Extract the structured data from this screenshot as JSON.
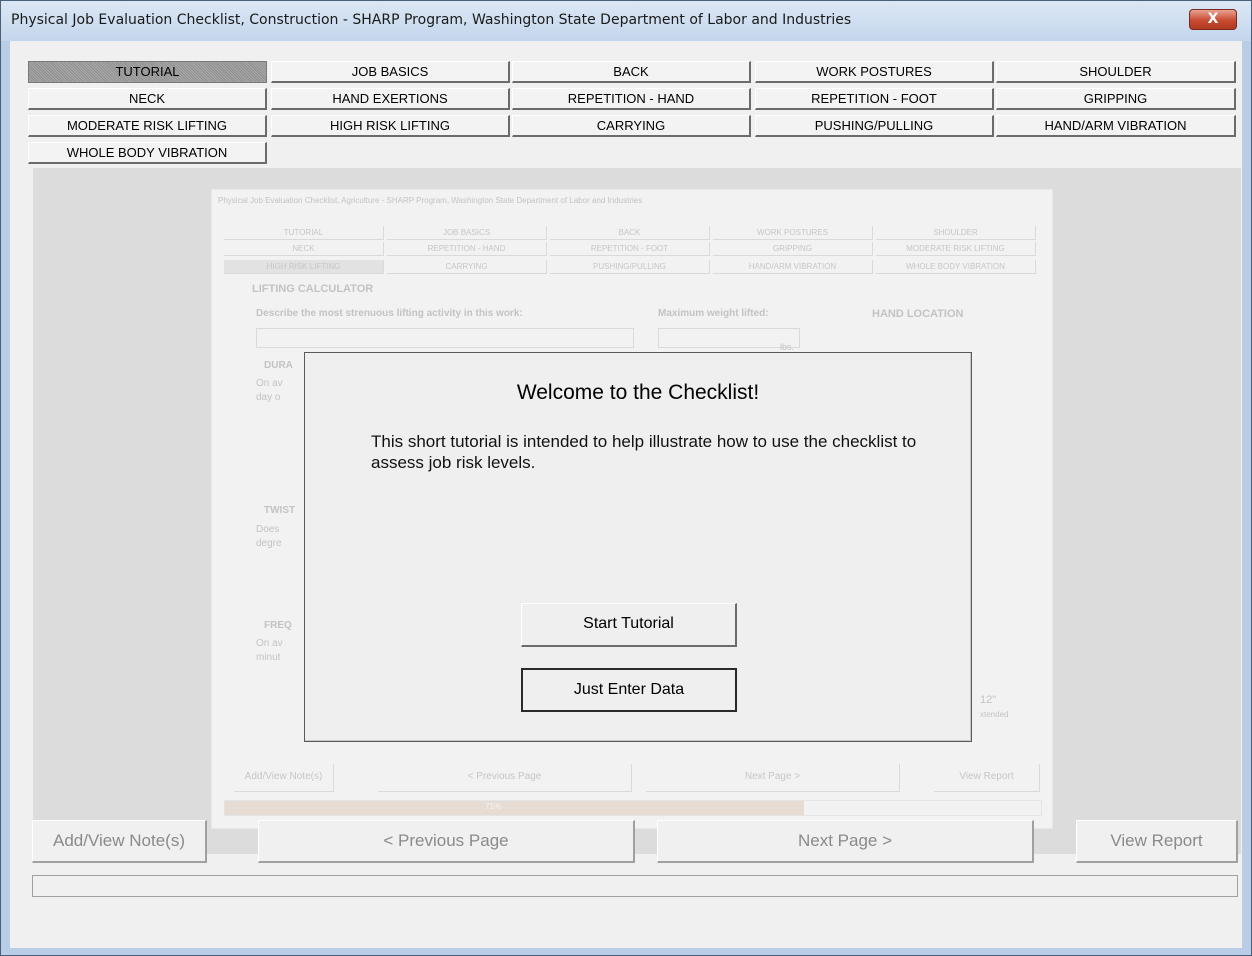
{
  "window": {
    "title": "Physical Job Evaluation Checklist, Construction - SHARP Program, Washington State Department of Labor and Industries",
    "close_glyph": "X"
  },
  "tabs": [
    "TUTORIAL",
    "JOB BASICS",
    "BACK",
    "WORK POSTURES",
    "SHOULDER",
    "NECK",
    "HAND EXERTIONS",
    "REPETITION - HAND",
    "REPETITION - FOOT",
    "GRIPPING",
    "MODERATE RISK LIFTING",
    "HIGH RISK LIFTING",
    "CARRYING",
    "PUSHING/PULLING",
    "HAND/ARM VIBRATION",
    "WHOLE BODY VIBRATION"
  ],
  "active_tab": "TUTORIAL",
  "background_image": {
    "title": "Physical Job Evaluation Checklist, Agriculture - SHARP Program, Washington State Department of Labor and Industries",
    "tabs": [
      "TUTORIAL",
      "JOB BASICS",
      "BACK",
      "WORK POSTURES",
      "SHOULDER",
      "NECK",
      "REPETITION - HAND",
      "REPETITION - FOOT",
      "GRIPPING",
      "MODERATE RISK LIFTING",
      "HIGH RISK LIFTING",
      "CARRYING",
      "PUSHING/PULLING",
      "HAND/ARM VIBRATION",
      "WHOLE BODY VIBRATION"
    ],
    "section_title": "LIFTING CALCULATOR",
    "question": "Describe the most strenuous lifting activity in this work:",
    "max_weight_label": "Maximum weight lifted:",
    "unit": "lbs.",
    "hand_location": "HAND LOCATION",
    "dur": "DURA",
    "dur_text_1": "On av",
    "dur_text_2": "day o",
    "twist": "TWIST",
    "twist_text_1": "Does",
    "twist_text_2": "degre",
    "freq": "FREQ",
    "freq_text_1": "On av",
    "freq_text_2": "minut",
    "dist": "12\"",
    "dist_sub": "xtended",
    "buttons": [
      "Add/View Note(s)",
      "< Previous Page",
      "Next Page >",
      "View Report"
    ],
    "progress_label": "71%",
    "progress_fraction": 0.71
  },
  "dialog": {
    "title": "Welcome to the Checklist!",
    "body": "This short tutorial is intended to help illustrate how to use the checklist to assess job risk levels.",
    "start_label": "Start Tutorial",
    "skip_label": "Just Enter Data"
  },
  "bottom_buttons": {
    "notes": "Add/View Note(s)",
    "previous": "< Previous Page",
    "next": "Next Page >",
    "report": "View Report"
  },
  "status": ""
}
